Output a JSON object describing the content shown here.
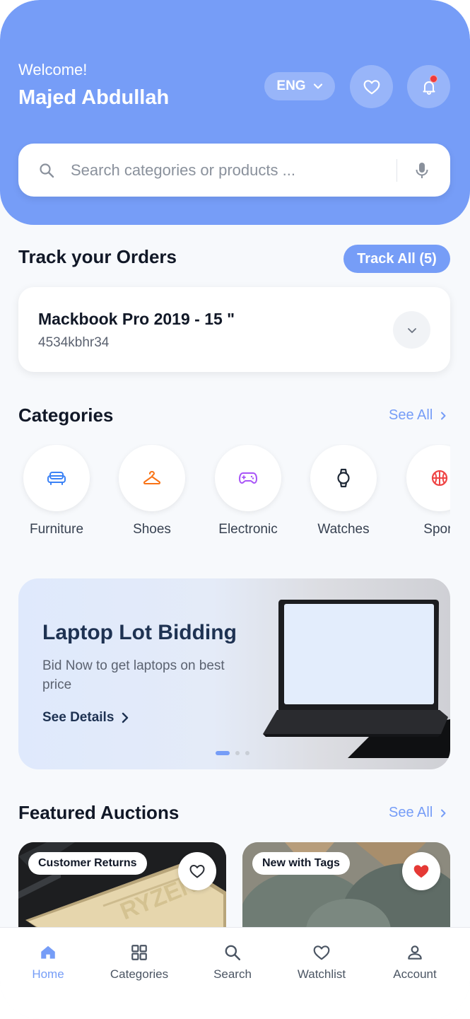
{
  "header": {
    "welcome": "Welcome!",
    "username": "Majed Abdullah",
    "language": "ENG",
    "has_notification": true
  },
  "search": {
    "placeholder": "Search categories or products ..."
  },
  "orders": {
    "title": "Track your Orders",
    "track_all_label": "Track All (5)",
    "items": [
      {
        "name": "Mackbook Pro 2019 - 15 \"",
        "id": "4534kbhr34"
      }
    ]
  },
  "categories": {
    "title": "Categories",
    "see_all": "See All",
    "items": [
      {
        "label": "Furniture",
        "icon": "sofa-icon",
        "color": "#3b82f6"
      },
      {
        "label": "Shoes",
        "icon": "hanger-icon",
        "color": "#f97316"
      },
      {
        "label": "Electronic",
        "icon": "gamepad-icon",
        "color": "#a855f7"
      },
      {
        "label": "Watches",
        "icon": "watch-icon",
        "color": "#1f2937"
      },
      {
        "label": "Sport",
        "icon": "basketball-icon",
        "color": "#ef4444"
      }
    ]
  },
  "banner": {
    "title": "Laptop Lot Bidding",
    "subtitle": "Bid Now to get laptops on best price",
    "link": "See Details",
    "slide_count": 3,
    "active_slide": 1
  },
  "auctions": {
    "title": "Featured Auctions",
    "see_all": "See All",
    "items": [
      {
        "tag": "Customer Returns",
        "favorited": false,
        "image": "ryzen-cpu-photo"
      },
      {
        "tag": "New with Tags",
        "favorited": true,
        "image": "clothes-on-hangers-photo"
      }
    ]
  },
  "nav": {
    "items": [
      {
        "label": "Home",
        "icon": "home-icon",
        "active": true
      },
      {
        "label": "Categories",
        "icon": "grid-icon",
        "active": false
      },
      {
        "label": "Search",
        "icon": "search-icon",
        "active": false
      },
      {
        "label": "Watchlist",
        "icon": "heart-icon",
        "active": false
      },
      {
        "label": "Account",
        "icon": "user-icon",
        "active": false
      }
    ]
  },
  "colors": {
    "primary": "#769df7",
    "notification": "#ef3b3b",
    "favorite": "#e53935"
  }
}
